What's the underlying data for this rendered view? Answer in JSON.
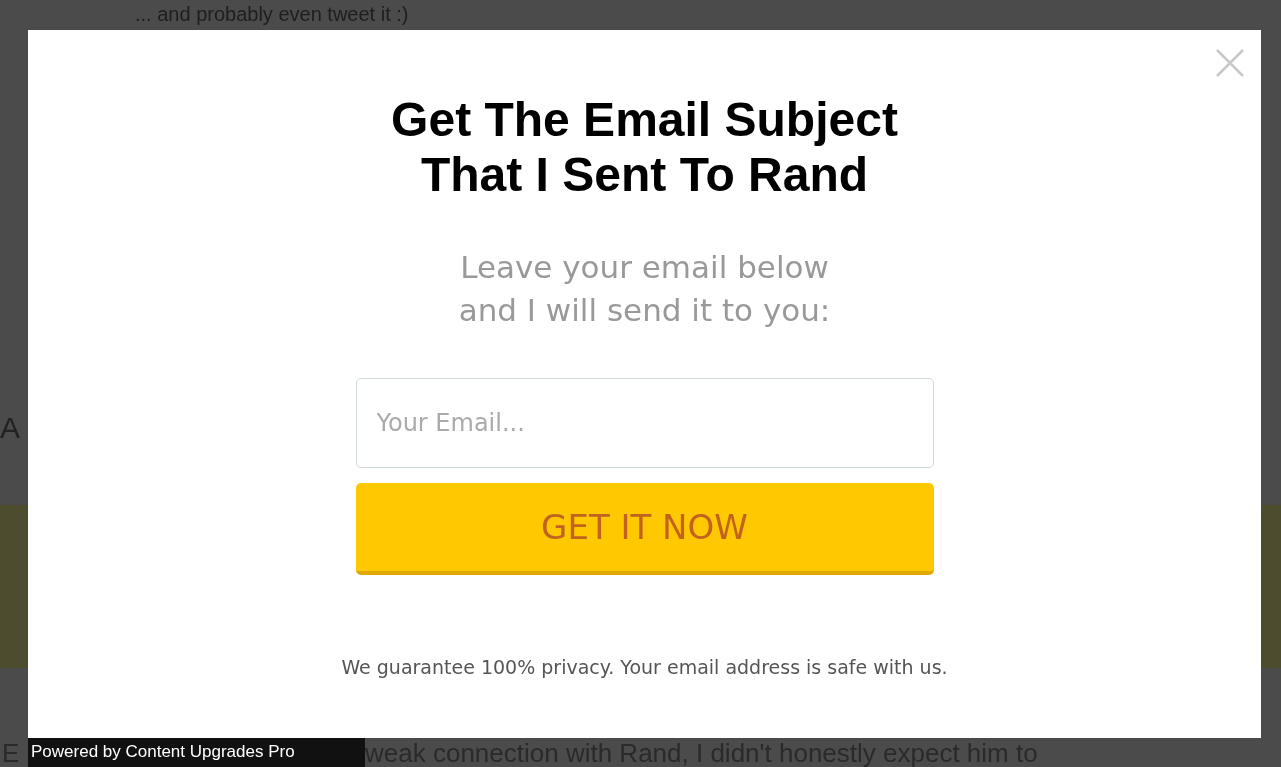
{
  "background_page": {
    "lines": [
      "... and probably even tweet it :)",
      "A",
      "E",
      "weak connection with Rand, I didn't honestly expect him to"
    ]
  },
  "popup": {
    "title": "Get The Email Subject That I Sent To Rand",
    "subtitle": "Leave your email below and I will send it to you:",
    "email_field": {
      "placeholder": "Your Email..."
    },
    "button": "GET IT NOW",
    "privacy_note": "We guarantee 100% privacy. Your email address is safe with us."
  },
  "footer": {
    "powered_by": "Powered by Content Upgrades Pro"
  }
}
